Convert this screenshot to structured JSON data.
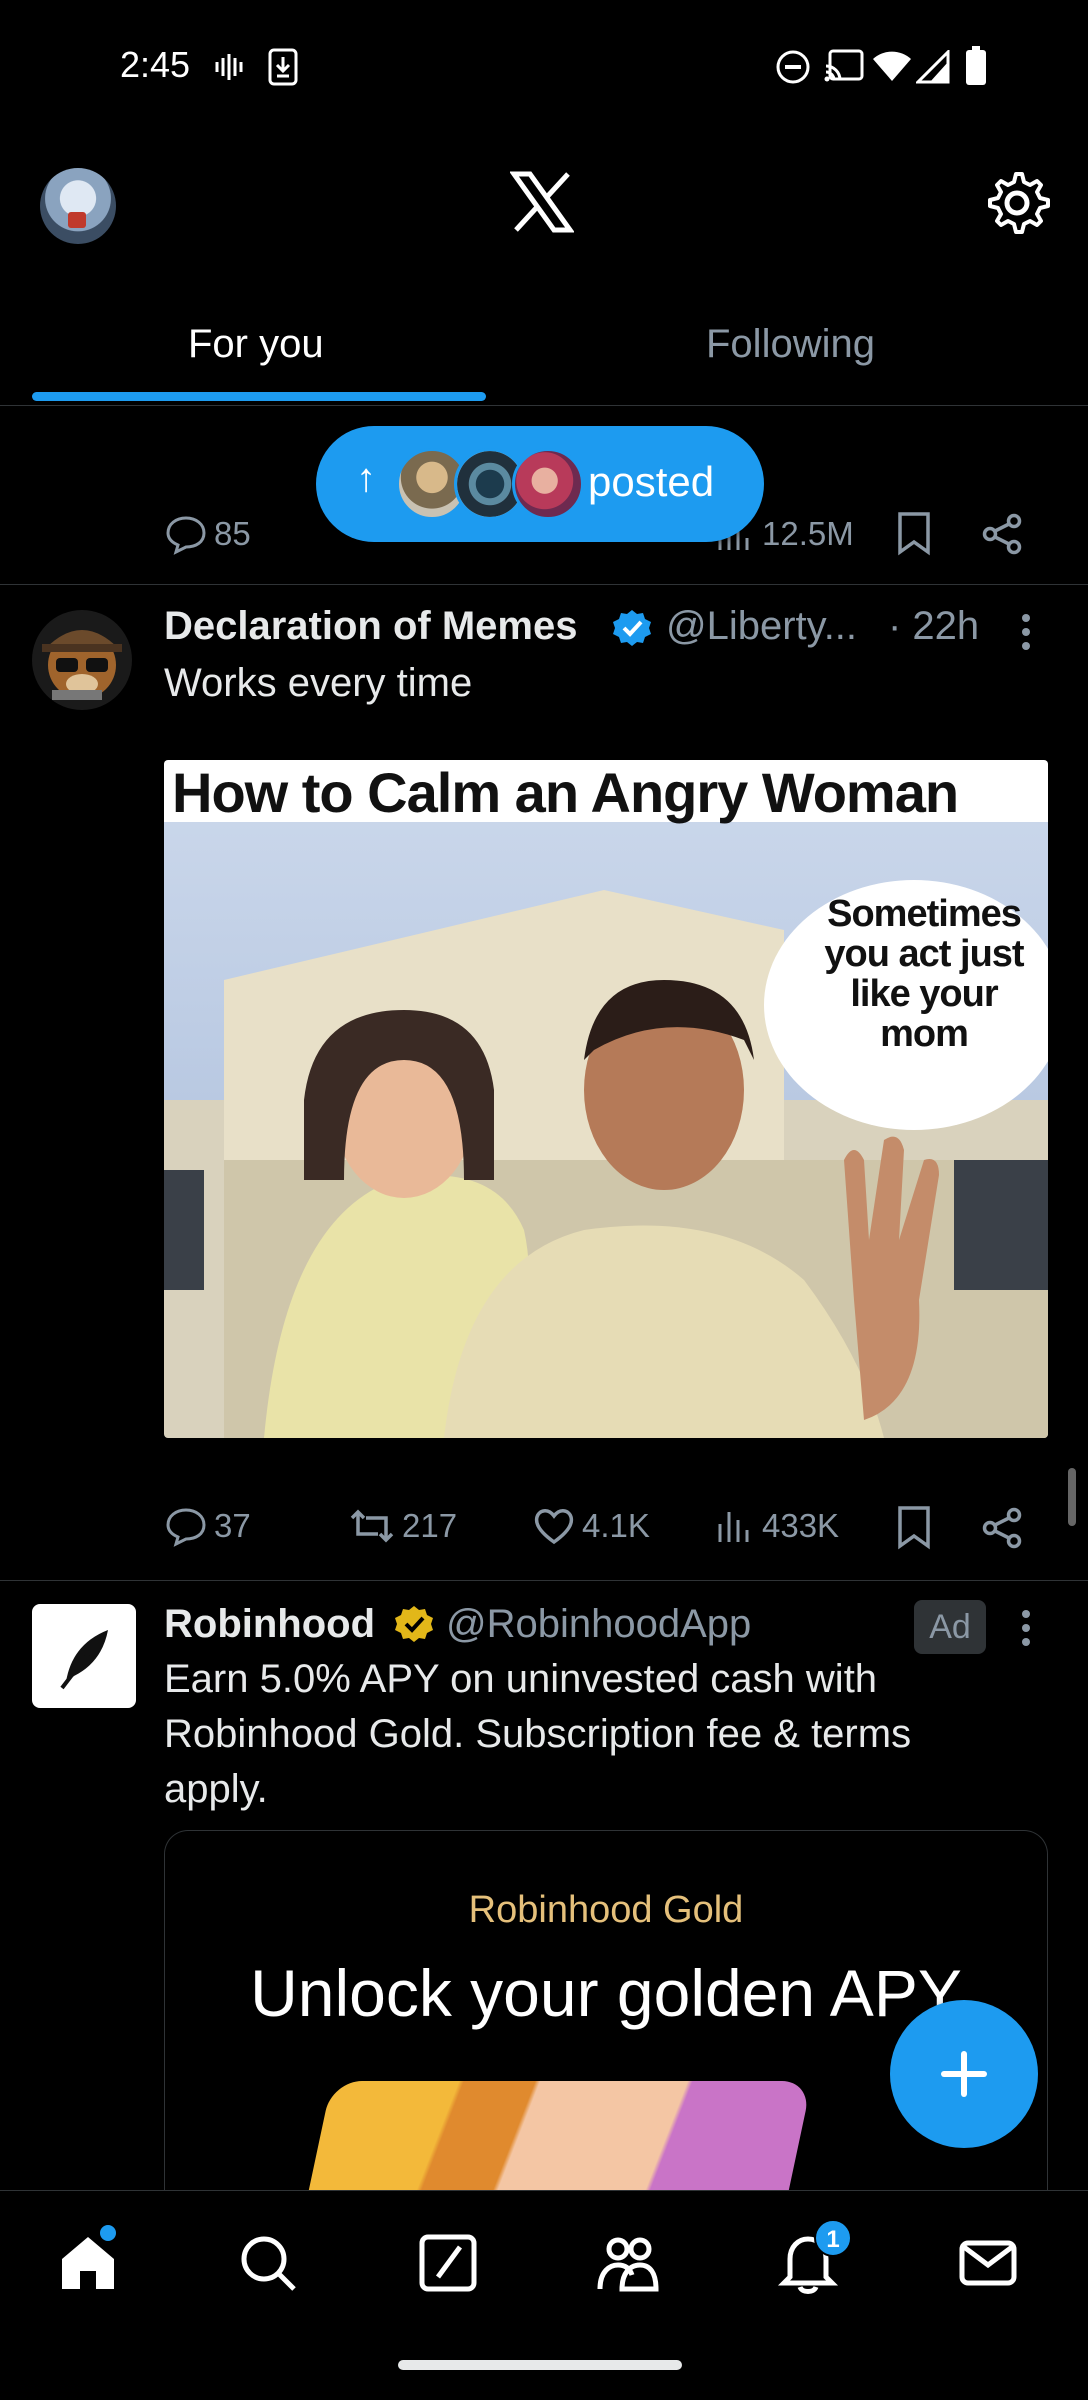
{
  "status_bar": {
    "time": "2:45",
    "icons": [
      "voicemail-icon",
      "download-icon",
      "dnd-icon",
      "cast-icon",
      "wifi-icon",
      "signal-icon",
      "battery-icon"
    ]
  },
  "header": {
    "logo": "X",
    "tabs": [
      {
        "label": "For you",
        "active": true
      },
      {
        "label": "Following",
        "active": false
      }
    ]
  },
  "new_posts_pill": {
    "text": "posted"
  },
  "prev_tweet_actions": {
    "replies": "85",
    "views": "12.5M"
  },
  "tweet1": {
    "display_name": "Declaration of Memes",
    "verified": true,
    "handle": "@Liberty...",
    "time": "· 22h",
    "text": "Works every time",
    "image": {
      "title": "How to Calm an Angry Woman",
      "bubble": "Sometimes you act just like your mom"
    },
    "actions": {
      "replies": "37",
      "reposts": "217",
      "likes": "4.1K",
      "views": "433K"
    }
  },
  "tweet2": {
    "display_name": "Robinhood",
    "verified": true,
    "handle": "@RobinhoodApp",
    "ad_label": "Ad",
    "text": "Earn 5.0% APY on uninvested cash with Robinhood Gold. Subscription fee & terms apply.",
    "card": {
      "brand": "Robinhood Gold",
      "headline": "Unlock your golden APY"
    }
  },
  "bottom_nav": {
    "items": [
      "home-icon",
      "search-icon",
      "grok-icon",
      "communities-icon",
      "notifications-icon",
      "messages-icon"
    ],
    "notification_count": "1"
  },
  "colors": {
    "accent": "#1d9bf0",
    "background": "#000000",
    "secondary_text": "#8b98a5"
  }
}
